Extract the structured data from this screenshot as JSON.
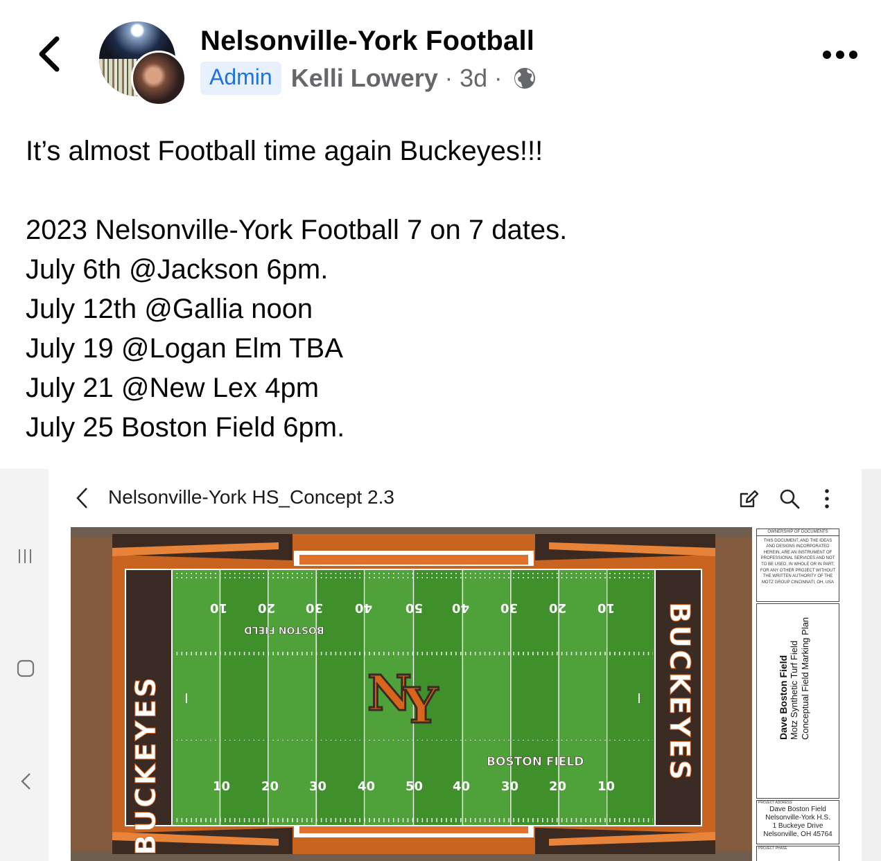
{
  "header": {
    "page_name": "Nelsonville-York Football",
    "role_badge": "Admin",
    "author": "Kelli Lowery",
    "separator": "·",
    "time": "3d",
    "icons": {
      "back": "chevron-left-icon",
      "more": "more-horizontal-icon",
      "audience": "globe-icon"
    }
  },
  "post": {
    "text": "It’s almost Football time again Buckeyes!!!\n\n2023 Nelsonville-York Football 7 on 7 dates.\nJuly 6th @Jackson 6pm.\nJuly 12th @Gallia noon\nJuly 19 @Logan Elm TBA\nJuly 21 @New Lex 4pm\nJuly 25 Boston Field 6pm."
  },
  "attachment": {
    "document_title": "Nelsonville-York HS_Concept 2.3",
    "toolbar_icons": [
      "edit-icon",
      "search-icon",
      "more-vertical-icon"
    ],
    "system_nav_icons": [
      "recent-apps-icon",
      "home-icon",
      "back-icon"
    ],
    "field": {
      "endzone_left_text": "BUCKEYES",
      "endzone_right_text": "BUCKEYES",
      "center_logo_letters": [
        "N",
        "Y"
      ],
      "field_name_text": "BOSTON FIELD",
      "yard_numbers": [
        "10",
        "20",
        "30",
        "40",
        "50",
        "40",
        "30",
        "20",
        "10"
      ],
      "colors": {
        "turf": "#3f8f2b",
        "turf_light": "#4fa13a",
        "endzone": "#3a2b24",
        "orange": "#d9641d",
        "track": "#8a4f2b"
      }
    },
    "legend": {
      "ownership_header": "OWNERSHIP OF DOCUMENTS",
      "ownership_text": "THIS DOCUMENT, AND THE IDEAS AND DESIGNS INCORPORATED HEREIN, ARE AN INSTRUMENT OF PROFESSIONAL SERVICES AND NOT TO BE USED, IN WHOLE OR IN PART, FOR ANY OTHER PROJECT WITHOUT THE WRITTEN AUTHORITY OF THE MOTZ GROUP CINCINNATI, OH, USA",
      "title_line1": "Dave Boston Field",
      "title_line2": "Motz Synthetic Turf Field",
      "title_line3": "Conceptual Field Marking Plan",
      "project_address_header": "PROJECT ADDRESS",
      "address_line1": "Dave Boston Field",
      "address_line2": "Nelsonville-York H.S.",
      "address_line3": "1 Buckeye Drive",
      "address_line4": "Nelsonville, OH  45764",
      "project_phase_header": "PROJECT PHASE"
    }
  }
}
